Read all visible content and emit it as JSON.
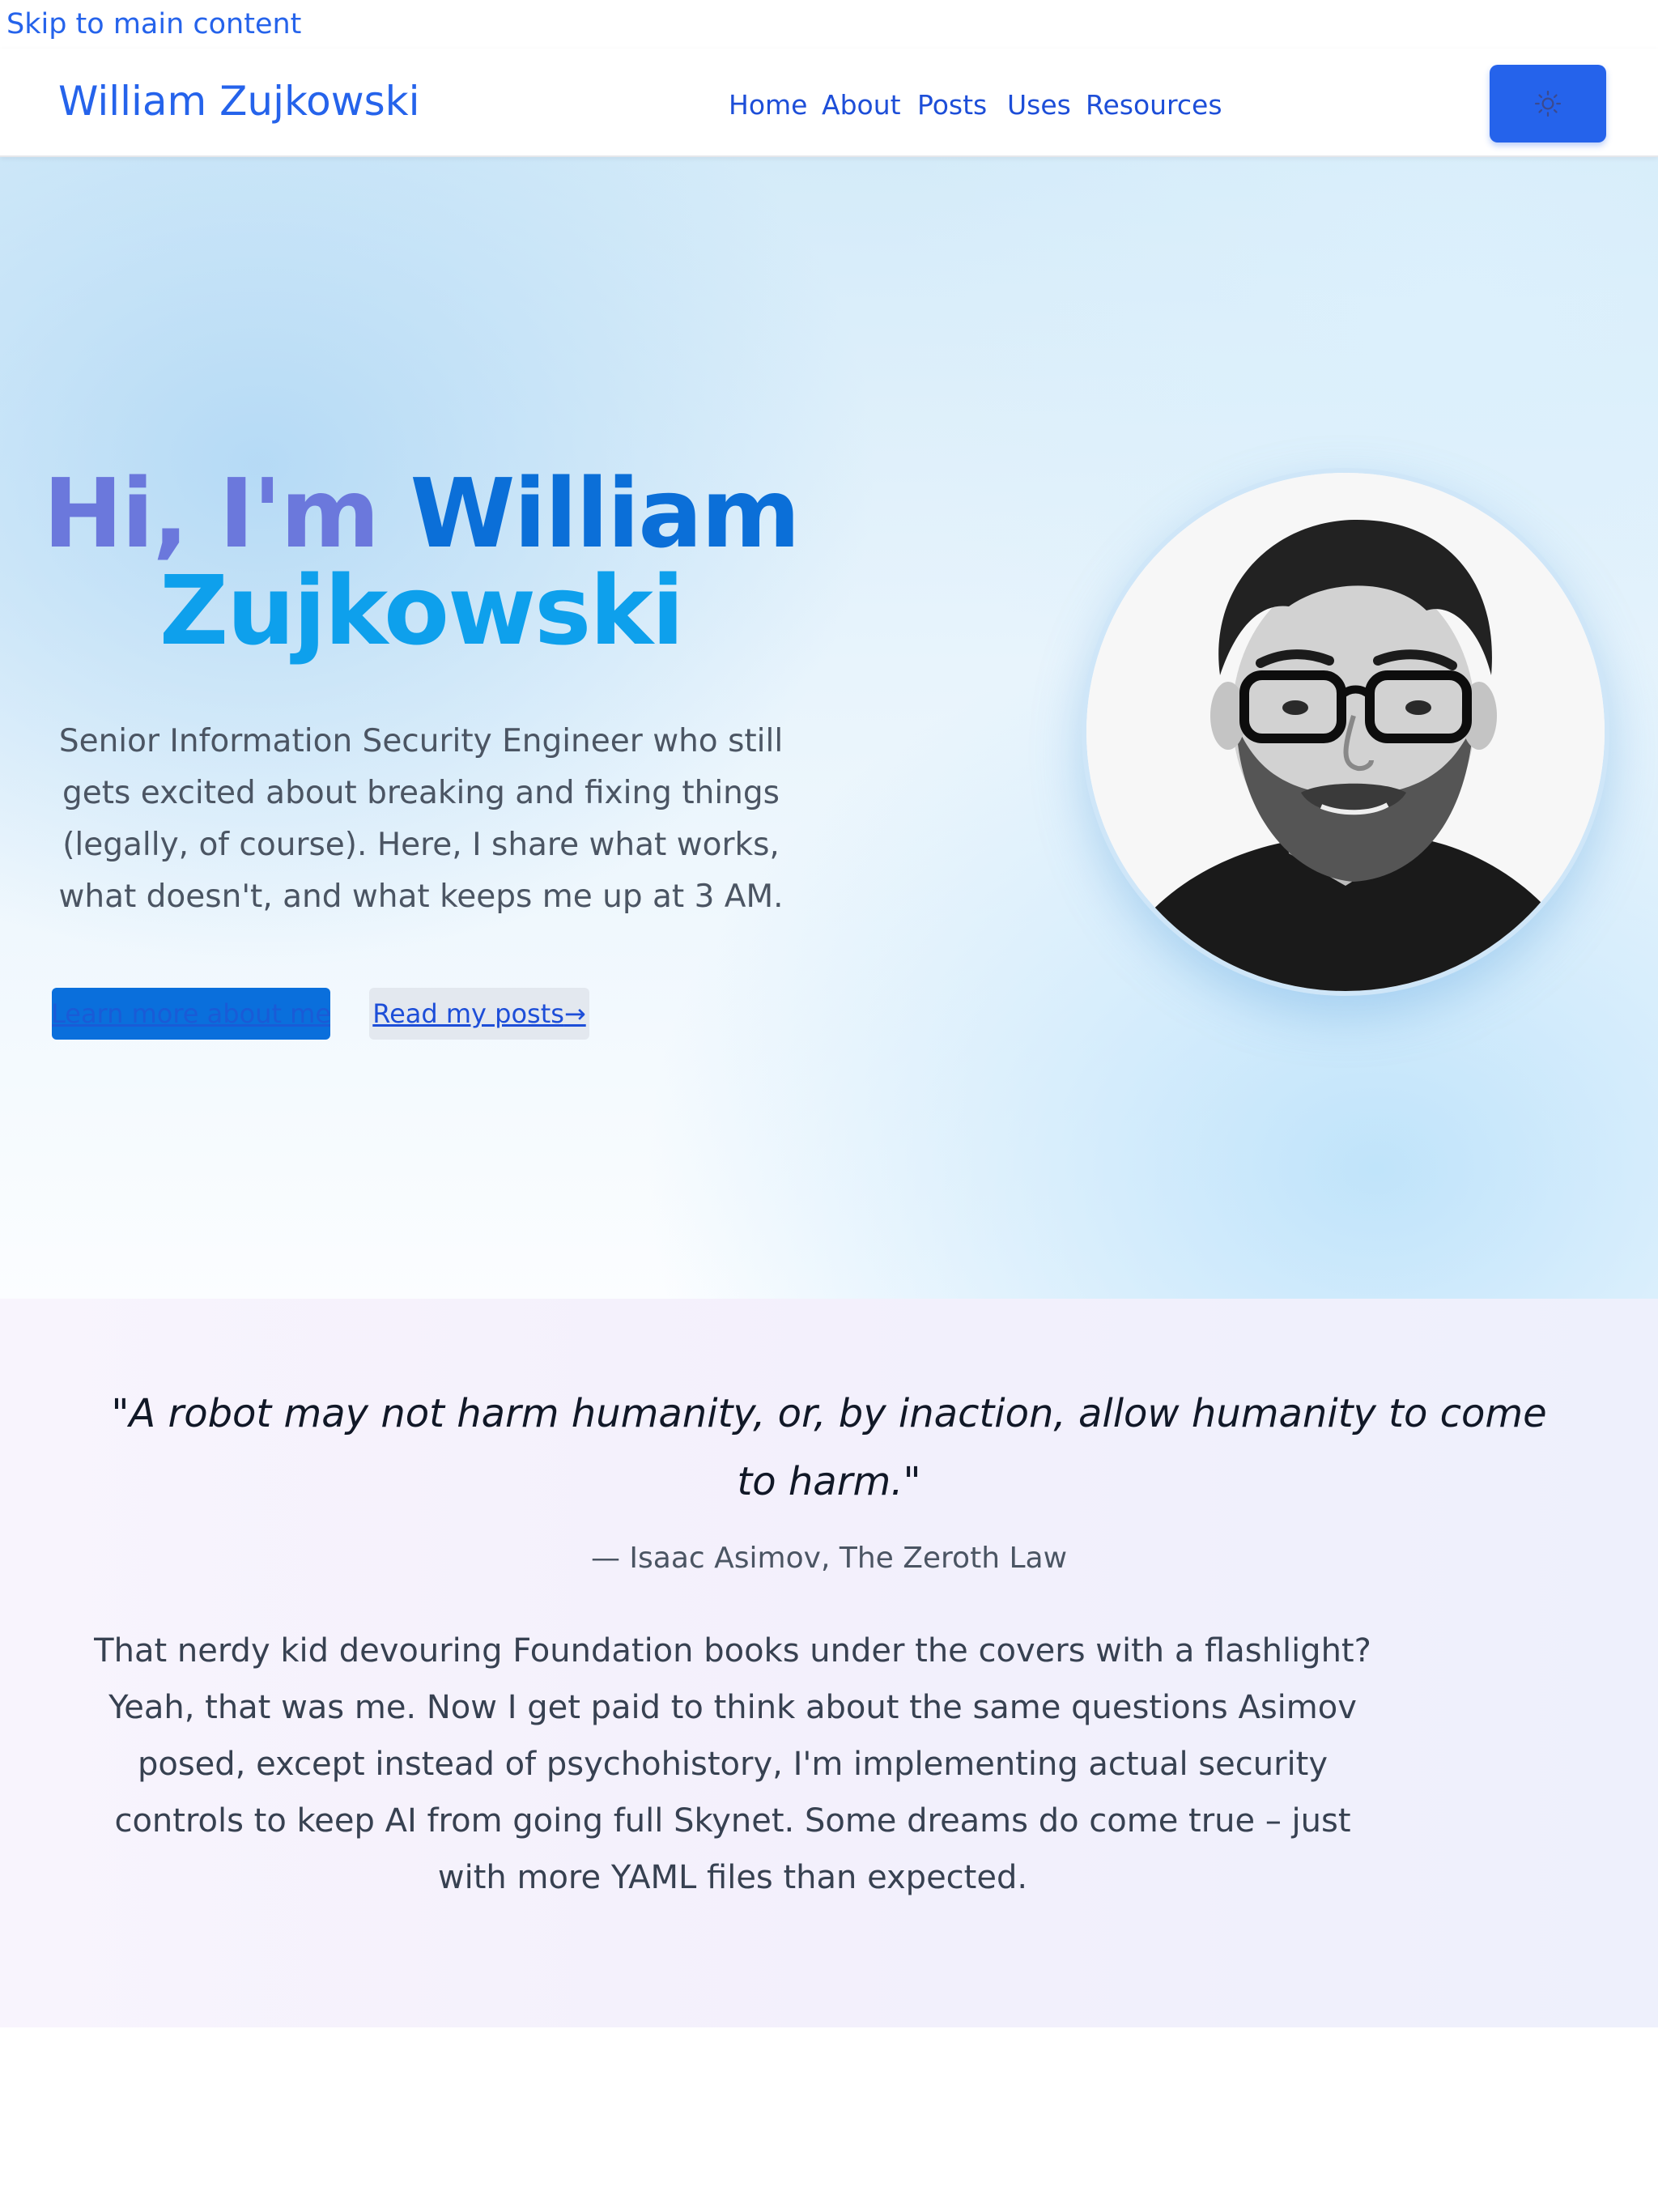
{
  "skip_link": "Skip to main content",
  "header": {
    "brand": "William Zujkowski",
    "nav": [
      "Home",
      "About",
      "Posts",
      "Uses",
      "Resources"
    ],
    "theme_icon": "sun-icon"
  },
  "hero": {
    "greeting": "Hi, I'm",
    "first_name": "William",
    "last_name": "Zujkowski",
    "description": "Senior Information Security Engineer who still gets excited about breaking and fixing things (legally, of course). Here, I share what works, what doesn't, and what keeps me up at 3 AM.",
    "primary_button": "Learn more about me",
    "secondary_button": "Read my posts",
    "secondary_button_arrow": "→"
  },
  "quote_section": {
    "quote": "\"A robot may not harm humanity, or, by inaction, allow humanity to come to harm.\"",
    "attribution": "— Isaac Asimov, The Zeroth Law",
    "story": "That nerdy kid devouring Foundation books under the covers with a flashlight? Yeah, that was me. Now I get paid to think about the same questions Asimov posed, except instead of psychohistory, I'm implementing actual security controls to keep AI from going full Skynet. Some dreams do come true – just with more YAML files than expected."
  },
  "colors": {
    "accent": "#2563eb",
    "title_gradient_start": "#6b78dc",
    "title_gradient_end": "#0ea0ec"
  }
}
